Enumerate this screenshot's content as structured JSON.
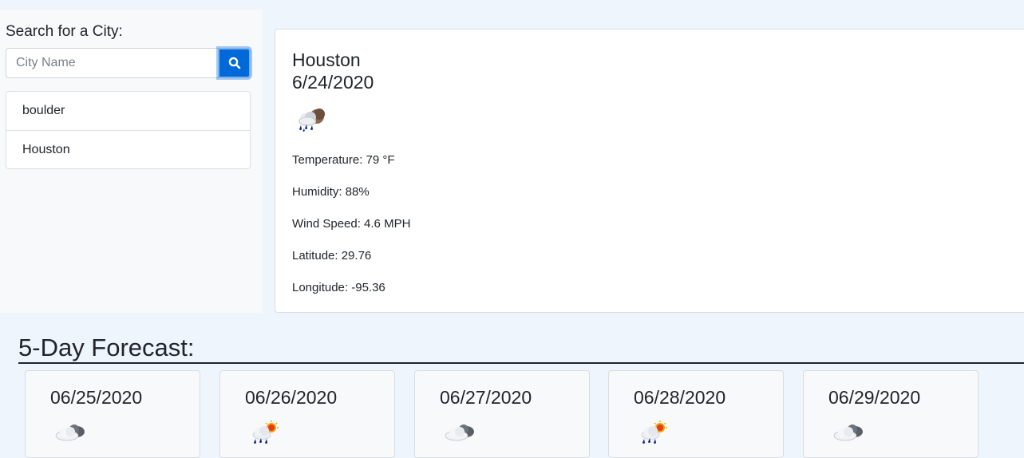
{
  "sidebar": {
    "search_label": "Search for a City:",
    "search_placeholder": "City Name",
    "search_icon": "search-icon",
    "history": [
      "boulder",
      "Houston"
    ]
  },
  "current": {
    "city": "Houston",
    "date": "6/24/2020",
    "icon": "rain-night-icon",
    "temperature": "Temperature: 79 °F",
    "humidity": "Humidity: 88%",
    "wind": "Wind Speed: 4.6 MPH",
    "latitude": "Latitude: 29.76",
    "longitude": "Longitude: -95.36"
  },
  "forecast": {
    "title": "5-Day Forecast:",
    "days": [
      {
        "date": "06/25/2020",
        "icon": "cloudy-icon"
      },
      {
        "date": "06/26/2020",
        "icon": "rain-sun-icon"
      },
      {
        "date": "06/27/2020",
        "icon": "cloudy-icon"
      },
      {
        "date": "06/28/2020",
        "icon": "rain-sun-icon"
      },
      {
        "date": "06/29/2020",
        "icon": "cloudy-icon"
      }
    ]
  },
  "colors": {
    "accent": "#0069d9",
    "page_bg": "#eef5fc",
    "sidebar_bg": "#f7f9fb"
  }
}
